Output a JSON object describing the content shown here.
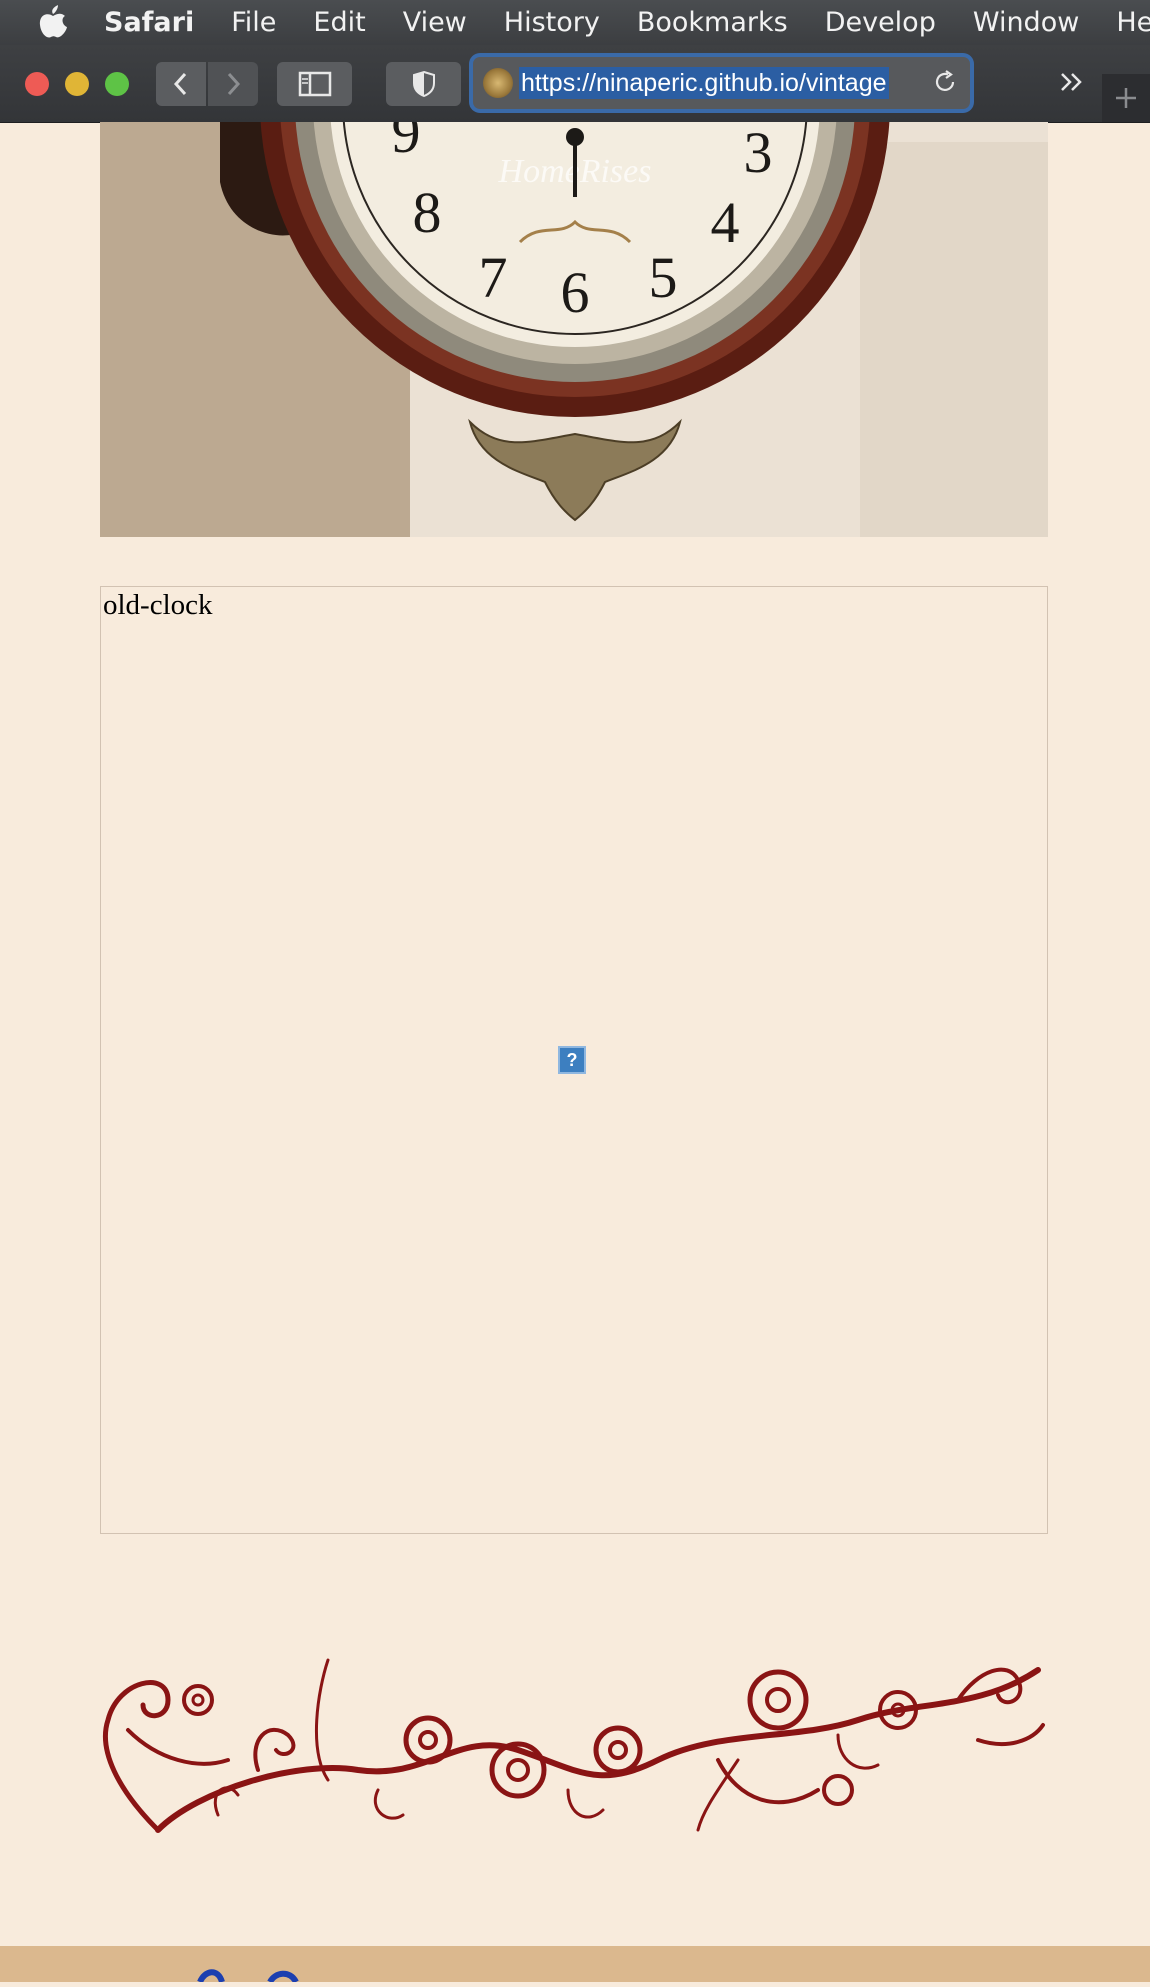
{
  "menubar": {
    "app": "Safari",
    "items": [
      "File",
      "Edit",
      "View",
      "History",
      "Bookmarks",
      "Develop",
      "Window",
      "Help"
    ]
  },
  "toolbar": {
    "url": "https://ninaperic.github.io/vintage"
  },
  "hero": {
    "clock_numerals": [
      "9",
      "3",
      "8",
      "4",
      "7",
      "6",
      "5"
    ],
    "watermark": "HomeRises"
  },
  "figure": {
    "caption": "old-clock",
    "broken_image_glyph": "?"
  },
  "colors": {
    "page_bg": "#f8ebdc",
    "ornament": "#8a1414",
    "footer": "#dbb88e",
    "url_highlight": "#2b5ea3"
  }
}
